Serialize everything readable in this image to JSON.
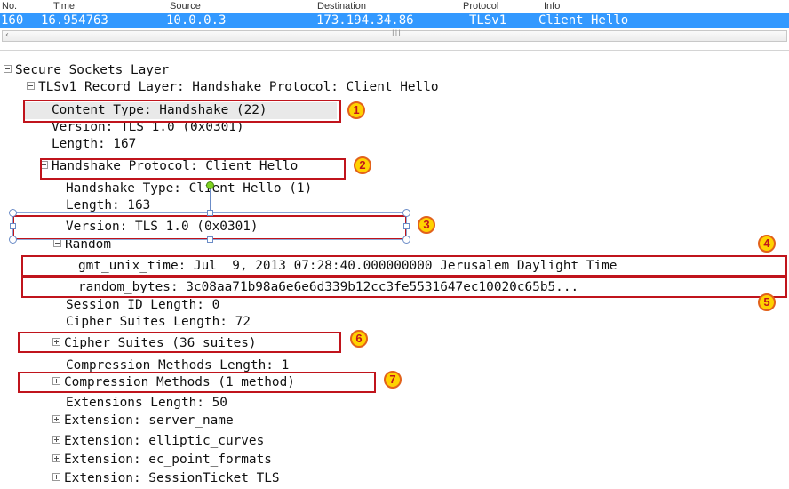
{
  "packet_list": {
    "columns": [
      "No.",
      "Time",
      "Source",
      "Destination",
      "Protocol",
      "Info"
    ],
    "selected_row": {
      "no": "160",
      "time": "16.954763",
      "source": "10.0.0.3",
      "destination": "173.194.34.86",
      "protocol": "TLSv1",
      "info": "Client Hello"
    },
    "scroll_left_glyph": "‹",
    "scroll_grip_glyph": "III"
  },
  "tree": {
    "l1": "Secure Sockets Layer",
    "l2": "TLSv1 Record Layer: Handshake Protocol: Client Hello",
    "l3": "Content Type: Handshake (22)",
    "l4": "Version: TLS 1.0 (0x0301)",
    "l5": "Length: 167",
    "l6": "Handshake Protocol: Client Hello",
    "l7": "Handshake Type: Client Hello (1)",
    "l8": "Length: 163",
    "l9": "Version: TLS 1.0 (0x0301)",
    "l10": "Random",
    "l11": "gmt_unix_time: Jul  9, 2013 07:28:40.000000000 Jerusalem Daylight Time",
    "l12": "random_bytes: 3c08aa71b98a6e6e6d339b12cc3fe5531647ec10020c65b5...",
    "l13": "Session ID Length: 0",
    "l14": "Cipher Suites Length: 72",
    "l15": "Cipher Suites (36 suites)",
    "l16": "Compression Methods Length: 1",
    "l17": "Compression Methods (1 method)",
    "l18": "Extensions Length: 50",
    "l19": "Extension: server_name",
    "l20": "Extension: elliptic_curves",
    "l21": "Extension: ec_point_formats",
    "l22": "Extension: SessionTicket TLS"
  },
  "badges": [
    "1",
    "2",
    "3",
    "4",
    "5",
    "6",
    "7"
  ],
  "colors": {
    "selection": "#3399ff",
    "annotation_box": "#c0141c",
    "badge_fill": "#ffd200",
    "badge_ring": "#e2621b"
  }
}
